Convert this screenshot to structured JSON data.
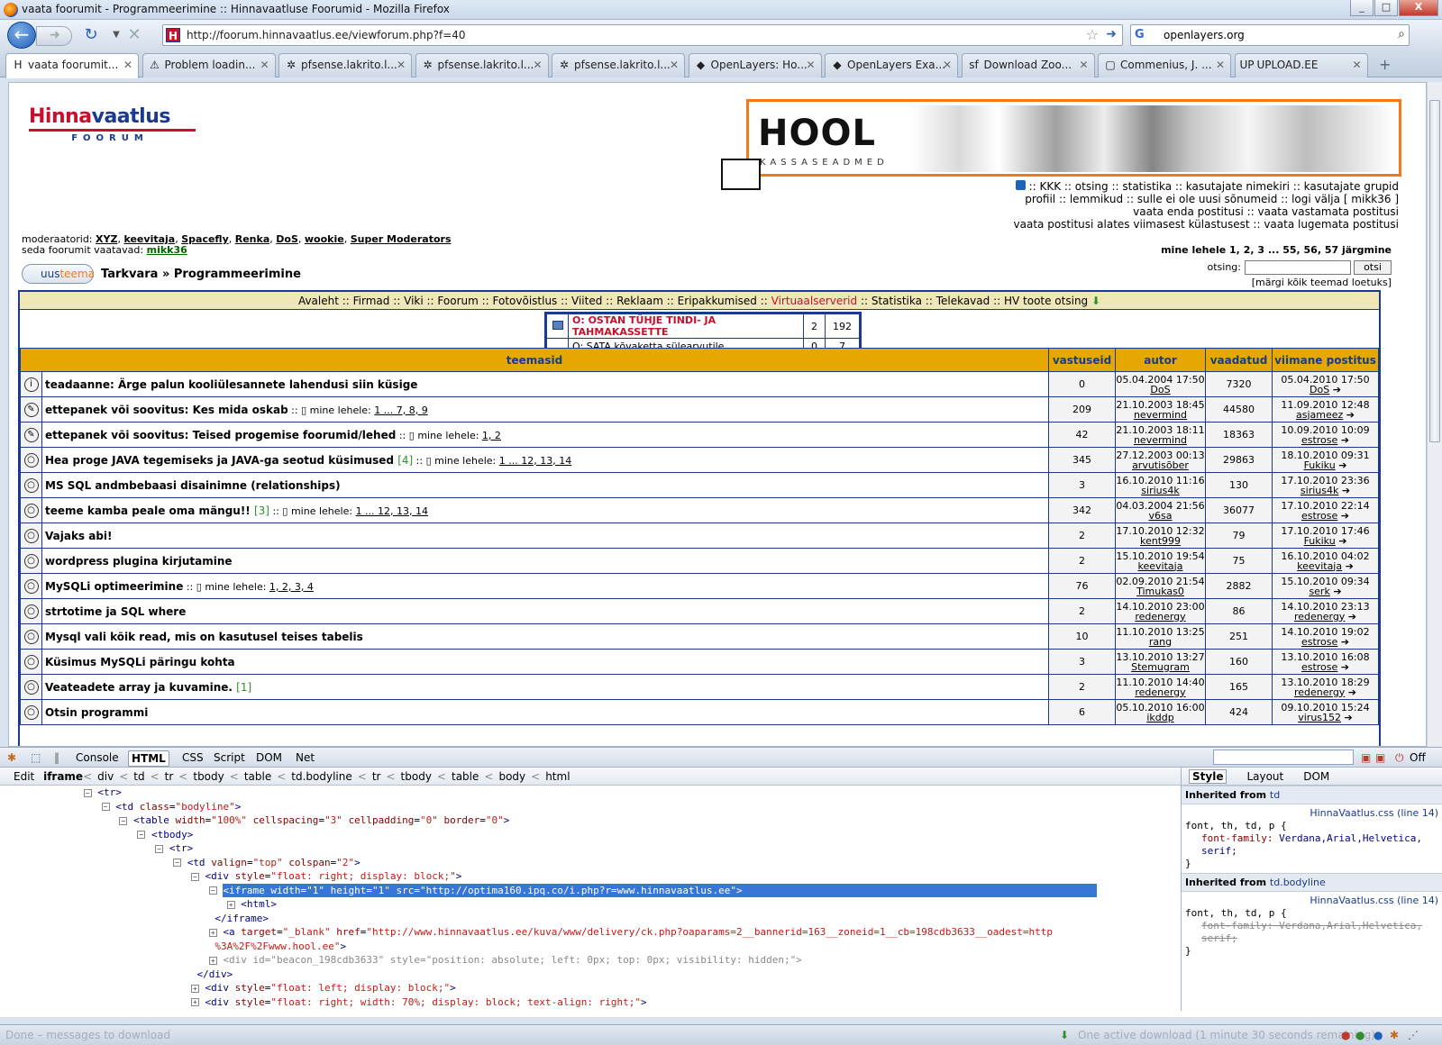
{
  "window": {
    "title": "vaata foorumit - Programmeerimine :: Hinnavaatluse Foorumid - Mozilla Firefox",
    "min": "_",
    "max": "□",
    "close": "X"
  },
  "nav": {
    "url": "http://foorum.hinnavaatlus.ee/viewforum.php?f=40",
    "search_value": "openlayers.org",
    "search_engine": "G"
  },
  "tabs": [
    {
      "label": "vaata foorumit...",
      "icon": "H"
    },
    {
      "label": "Problem loadin...",
      "icon": "⚠"
    },
    {
      "label": "pfsense.lakrito.l...",
      "icon": "✲"
    },
    {
      "label": "pfsense.lakrito.l...",
      "icon": "✲"
    },
    {
      "label": "pfsense.lakrito.l...",
      "icon": "✲"
    },
    {
      "label": "OpenLayers: Ho...",
      "icon": "◆"
    },
    {
      "label": "OpenLayers Exa...",
      "icon": "◆"
    },
    {
      "label": "Download Zoo...",
      "icon": "sf"
    },
    {
      "label": "Commenius, J. ...",
      "icon": "▢"
    },
    {
      "label": "UPLOAD.EE",
      "icon": "UP"
    }
  ],
  "site": {
    "logo_top": "Hinna",
    "logo_top2": "vaatlus",
    "logo_sub": "FOORUM",
    "banner_brand": "HOOL",
    "banner_sub": "KASSASEADMED",
    "links_line1": ":: KKK  :: otsing  :: statistika  :: kasutajate nimekiri  :: kasutajate grupid",
    "links_line2": "profiil  :: lemmikud  :: sulle ei ole uusi sõnumeid  :: logi välja [ mikk36 ]",
    "links_line3": "vaata enda postitusi  :: vaata vastamata postitusi",
    "links_line4": "vaata postitusi alates viimasest külastusest  :: vaata lugemata postitusi",
    "mods_label": "moderaatorid:",
    "mods": [
      "XYZ",
      "keevitaja",
      "Spacefly",
      "Renka",
      "DoS",
      "wookie",
      "Super Moderators"
    ],
    "viewers_label": "seda foorumit vaatavad:",
    "viewer": "mikk36",
    "pages": "mine lehele 1, 2, 3 ... 55, 56, 57  järgmine",
    "new_topic_a": "uus",
    "new_topic_b": "teema",
    "breadcrumb": "Tarkvara » Programmeerimine",
    "search_label": "otsing:",
    "search_button": "otsi",
    "mark_read": "[märgi kõik teemad loetuks]",
    "menu": [
      "Avaleht",
      "Firmad",
      "Viki",
      "Foorum",
      "Fotovõistlus",
      "Viited",
      "Reklaam",
      "Eripakkumised",
      "Virtuaalserverid",
      "Statistika",
      "Telekavad",
      "HV toote otsing"
    ],
    "ads": [
      {
        "title": "O: OSTAN TÜHJE TINDI- JA TAHMAKASSETTE",
        "a": "2",
        "b": "192",
        "red": true
      },
      {
        "title": "O: SATA kõvaketta sülearvutile",
        "a": "0",
        "b": "7",
        "red": false
      }
    ],
    "headers": [
      "teemasid",
      "vastuseid",
      "autor",
      "vaadatud",
      "viimane postitus"
    ],
    "topics": [
      {
        "icon": "i",
        "title": "teadaanne: Ärge palun kooliülesannete lahendusi siin küsige",
        "count": "",
        "pages": "",
        "replies": "0",
        "date": "05.04.2004 17:50",
        "author": "DoS",
        "views": "7320",
        "ldate": "05.04.2010 17:50",
        "luser": "DoS"
      },
      {
        "icon": "✎",
        "title": "ettepanek või soovitus: Kes mida oskab",
        "count": "",
        "pages": "1 ... 7, 8, 9",
        "replies": "209",
        "date": "21.10.2003 18:45",
        "author": "nevermind",
        "views": "44580",
        "ldate": "11.09.2010 12:48",
        "luser": "asjameez"
      },
      {
        "icon": "✎",
        "title": "ettepanek või soovitus: Teised progemise foorumid/lehed",
        "count": "",
        "pages": "1, 2",
        "replies": "42",
        "date": "21.10.2003 18:11",
        "author": "nevermind",
        "views": "18363",
        "ldate": "10.09.2010 10:09",
        "luser": "estrose"
      },
      {
        "icon": "○",
        "title": "Hea proge JAVA tegemiseks ja JAVA-ga seotud küsimused",
        "count": "[4]",
        "pages": "1 ... 12, 13, 14",
        "replies": "345",
        "date": "27.12.2003 00:13",
        "author": "arvutisõber",
        "views": "29863",
        "ldate": "18.10.2010 09:31",
        "luser": "Fukiku"
      },
      {
        "icon": "○",
        "title": "MS SQL andmbebaasi disainimne (relationships)",
        "count": "",
        "pages": "",
        "replies": "3",
        "date": "16.10.2010 11:16",
        "author": "sirius4k",
        "views": "130",
        "ldate": "17.10.2010 23:36",
        "luser": "sirius4k"
      },
      {
        "icon": "○",
        "title": "teeme kamba peale oma mängu!!",
        "count": "[3]",
        "pages": "1 ... 12, 13, 14",
        "replies": "342",
        "date": "04.03.2004 21:56",
        "author": "v6sa",
        "views": "36077",
        "ldate": "17.10.2010 22:14",
        "luser": "estrose"
      },
      {
        "icon": "○",
        "title": "Vajaks abi!",
        "count": "",
        "pages": "",
        "replies": "2",
        "date": "17.10.2010 12:32",
        "author": "kent999",
        "views": "79",
        "ldate": "17.10.2010 17:46",
        "luser": "Fukiku"
      },
      {
        "icon": "○",
        "title": "wordpress plugina kirjutamine",
        "count": "",
        "pages": "",
        "replies": "2",
        "date": "15.10.2010 19:54",
        "author": "keevitaja",
        "views": "75",
        "ldate": "16.10.2010 04:02",
        "luser": "keevitaja"
      },
      {
        "icon": "○",
        "title": "MySQLi optimeerimine",
        "count": "",
        "pages": "1, 2, 3, 4",
        "replies": "76",
        "date": "02.09.2010 21:54",
        "author": "Timukas0",
        "views": "2882",
        "ldate": "15.10.2010 09:34",
        "luser": "serk"
      },
      {
        "icon": "○",
        "title": "strtotime ja SQL where",
        "count": "",
        "pages": "",
        "replies": "2",
        "date": "14.10.2010 23:00",
        "author": "redenergy",
        "views": "86",
        "ldate": "14.10.2010 23:13",
        "luser": "redenergy"
      },
      {
        "icon": "○",
        "title": "Mysql vali kõik read, mis on kasutusel teises tabelis",
        "count": "",
        "pages": "",
        "replies": "10",
        "date": "11.10.2010 13:25",
        "author": "rang",
        "views": "251",
        "ldate": "14.10.2010 19:02",
        "luser": "estrose"
      },
      {
        "icon": "○",
        "title": "Küsimus MySQLi päringu kohta",
        "count": "",
        "pages": "",
        "replies": "3",
        "date": "13.10.2010 13:27",
        "author": "Stemugram",
        "views": "160",
        "ldate": "13.10.2010 16:08",
        "luser": "estrose"
      },
      {
        "icon": "○",
        "title": "Veateadete array ja kuvamine.",
        "count": "[1]",
        "pages": "",
        "replies": "2",
        "date": "11.10.2010 14:40",
        "author": "redenergy",
        "views": "165",
        "ldate": "13.10.2010 18:29",
        "luser": "redenergy"
      },
      {
        "icon": "○",
        "title": "Otsin programmi",
        "count": "",
        "pages": "",
        "replies": "6",
        "date": "05.10.2010 16:00",
        "author": "ikddp",
        "views": "424",
        "ldate": "09.10.2010 15:24",
        "luser": "virus152"
      }
    ],
    "pages_prefix": "mine lehele:"
  },
  "firebug": {
    "tabs": [
      "Console",
      "HTML",
      "CSS",
      "Script",
      "DOM",
      "Net"
    ],
    "off": "Off",
    "crumbs": [
      "Edit",
      "iframe",
      "div",
      "td",
      "tr",
      "tbody",
      "table",
      "td.bodyline",
      "tr",
      "tbody",
      "table",
      "body",
      "html"
    ],
    "side_tabs": [
      "Style",
      "Layout",
      "DOM"
    ],
    "inherit1": "Inherited from ",
    "inherit1b": "td",
    "src1": "HinnaVaatlus.css (line 14)",
    "inherit2": "Inherited from ",
    "inherit2b": "td.bodyline",
    "src2": "HinnaVaatlus.css (line 14)",
    "sel": "font, th, td, p {",
    "prop": "font-family:",
    "val": "Verdana,Arial,Helvetica,",
    "val2": "serif;",
    "close": "}"
  },
  "status": {
    "left": "Done – messages to download",
    "right": "One active download (1 minute 30 seconds remaining)"
  }
}
